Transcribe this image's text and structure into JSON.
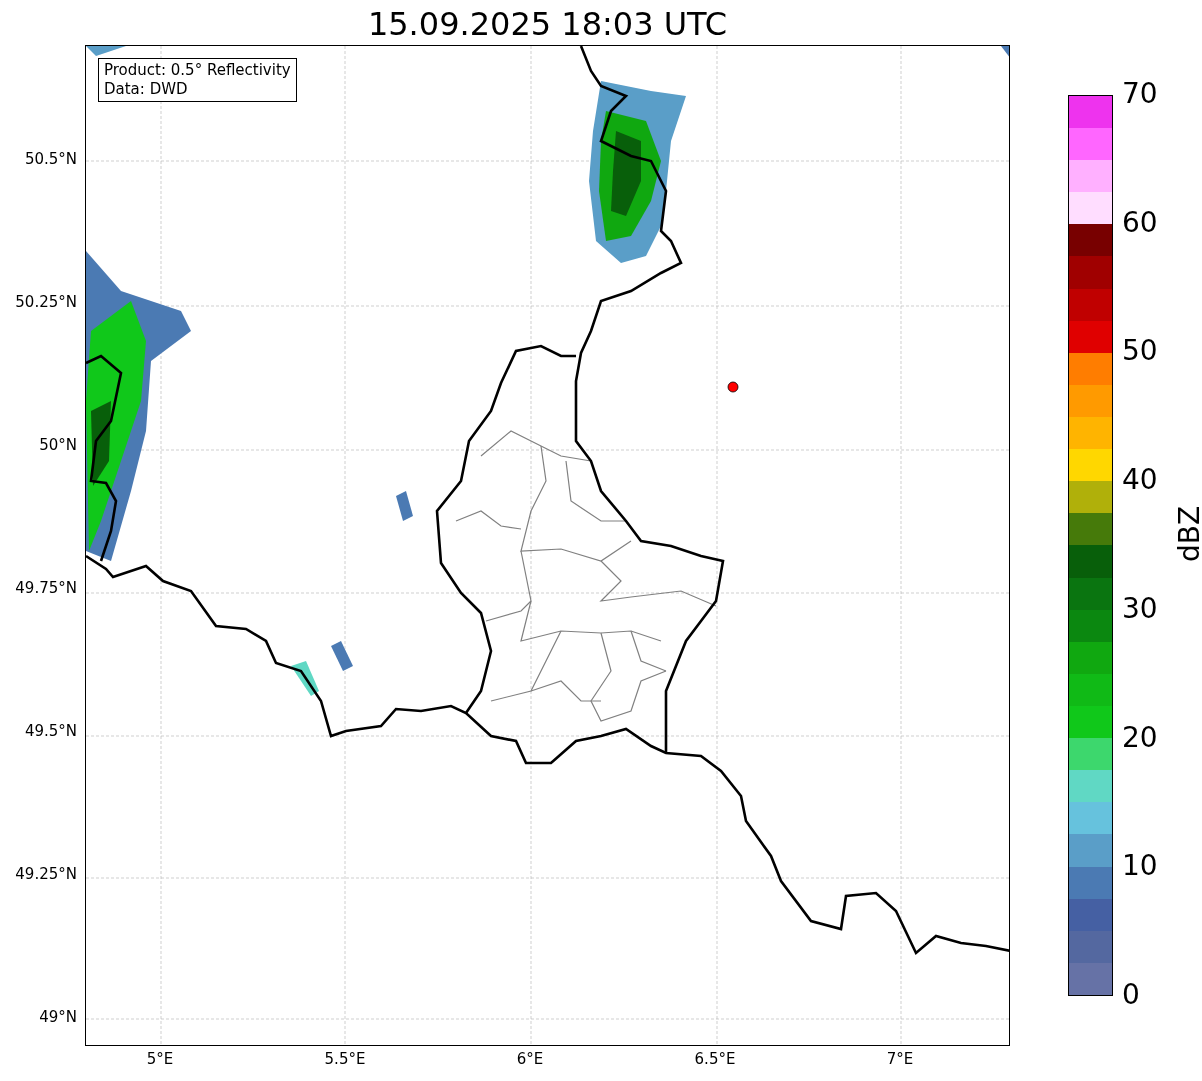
{
  "title": "15.09.2025 18:03 UTC",
  "info_box": [
    "Product: 0.5° Reflectivity",
    "Data: DWD"
  ],
  "map": {
    "lat_labels": [
      "50.5°N",
      "50.25°N",
      "50°N",
      "49.75°N",
      "49.5°N",
      "49.25°N",
      "49°N"
    ],
    "lon_labels": [
      "5°E",
      "5.5°E",
      "6°E",
      "6.5°E",
      "7°E"
    ]
  },
  "colorbar": {
    "label": "dBZ",
    "ticks": [
      "70",
      "60",
      "50",
      "40",
      "30",
      "20",
      "10",
      "0"
    ],
    "bins": [
      {
        "color": "#6672a6"
      },
      {
        "color": "#5468a0"
      },
      {
        "color": "#4560a3"
      },
      {
        "color": "#4b7ab3"
      },
      {
        "color": "#5a9ec8"
      },
      {
        "color": "#66c2dd"
      },
      {
        "color": "#60d8c4"
      },
      {
        "color": "#3dd76d"
      },
      {
        "color": "#10c81a"
      },
      {
        "color": "#10ba16"
      },
      {
        "color": "#10a810"
      },
      {
        "color": "#0b8810"
      },
      {
        "color": "#0a7510"
      },
      {
        "color": "#085f0a"
      },
      {
        "color": "#467a0a"
      },
      {
        "color": "#b0b00a"
      },
      {
        "color": "#ffd700"
      },
      {
        "color": "#ffb400"
      },
      {
        "color": "#ff9a00"
      },
      {
        "color": "#ff7d00"
      },
      {
        "color": "#e00000"
      },
      {
        "color": "#c00000"
      },
      {
        "color": "#a00000"
      },
      {
        "color": "#780000"
      },
      {
        "color": "#ffddff"
      },
      {
        "color": "#ffb0ff"
      },
      {
        "color": "#ff66ff"
      },
      {
        "color": "#ee33ee"
      }
    ]
  }
}
